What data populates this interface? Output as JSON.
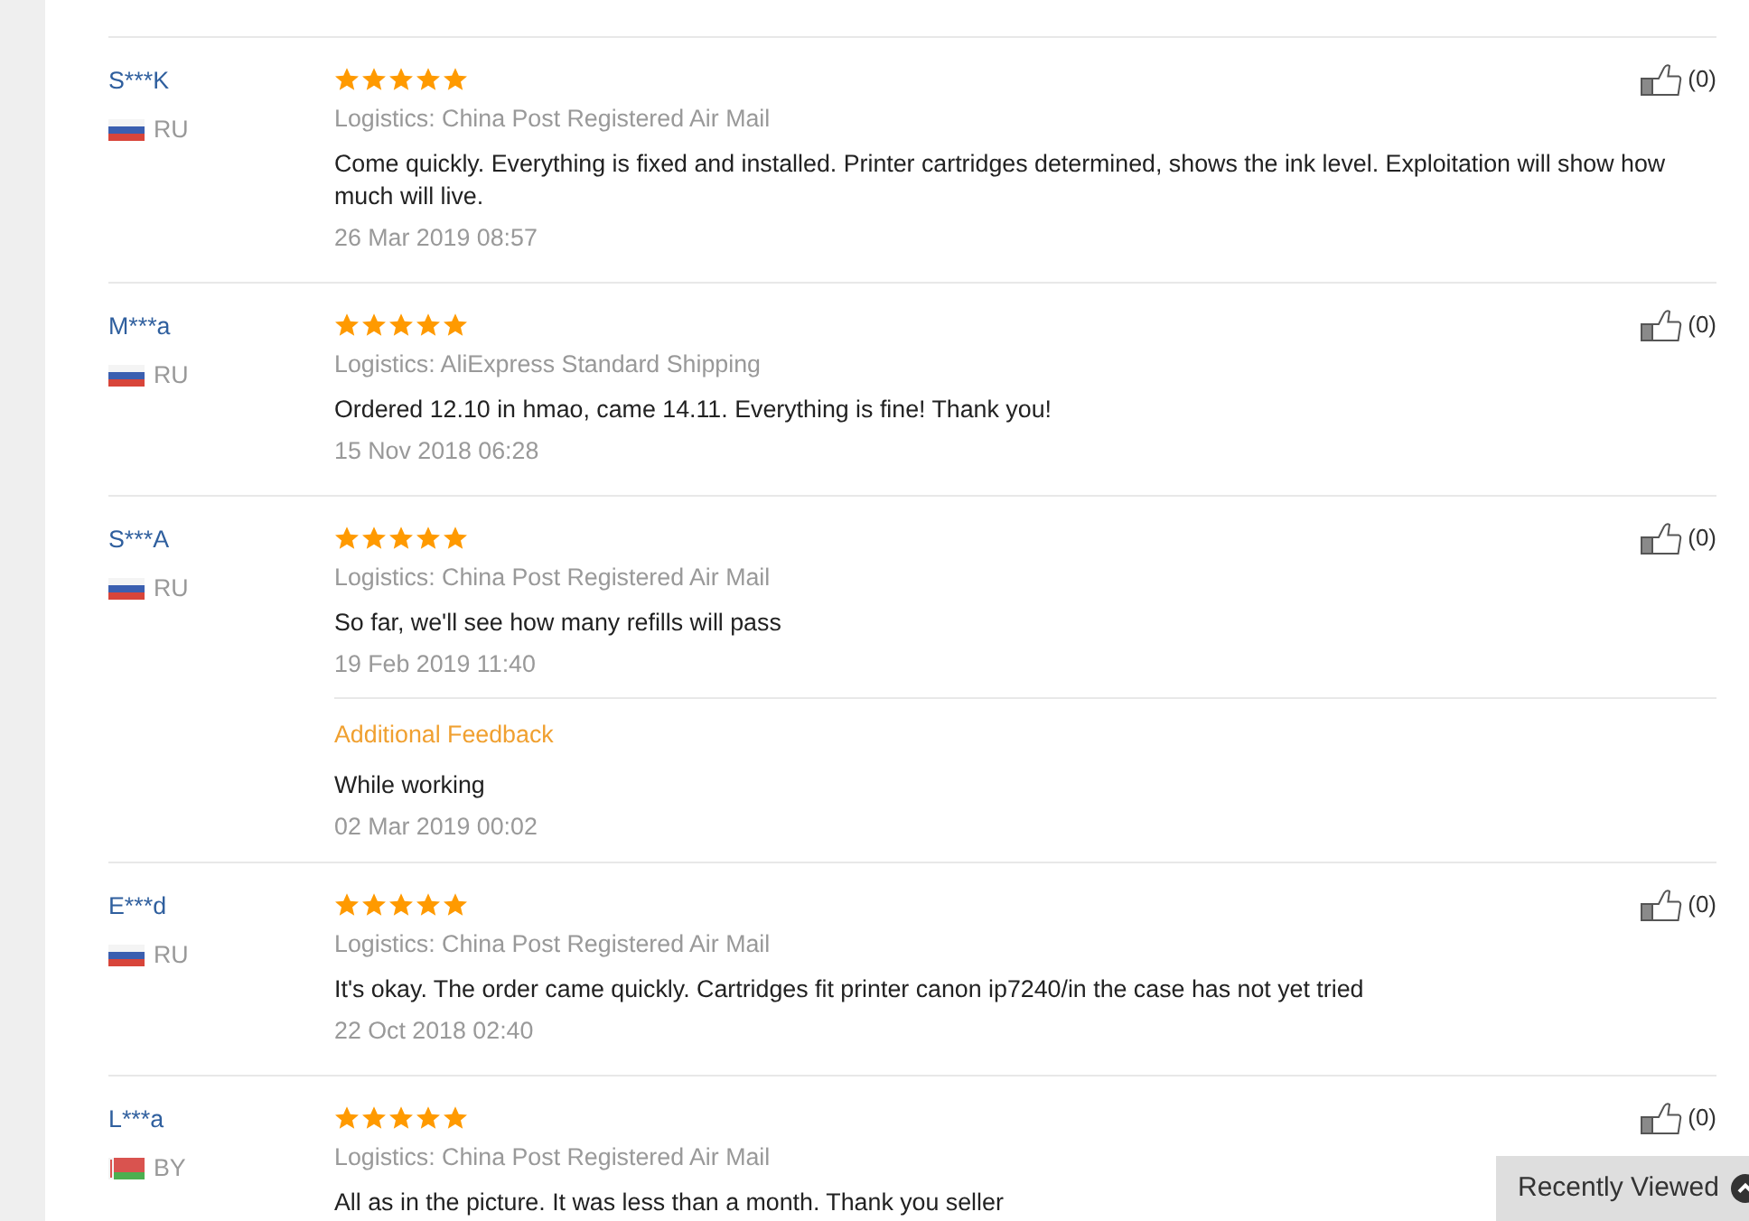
{
  "reviews": [
    {
      "user": "S***K",
      "flag": {
        "kind": "russia"
      },
      "country": "RU",
      "stars": 5,
      "likes": "(0)",
      "logistics": "Logistics: China Post Registered Air Mail",
      "text": "Come quickly. Everything is fixed and installed. Printer cartridges determined, shows the ink level. Exploitation will show how much will live.",
      "date": "26 Mar 2019 08:57"
    },
    {
      "user": "M***a",
      "flag": {
        "kind": "russia"
      },
      "country": "RU",
      "stars": 5,
      "likes": "(0)",
      "logistics": "Logistics: AliExpress Standard Shipping",
      "text": "Ordered 12.10 in hmao, came 14.11. Everything is fine! Thank you!",
      "date": "15 Nov 2018 06:28"
    },
    {
      "user": "S***A",
      "flag": {
        "kind": "russia"
      },
      "country": "RU",
      "stars": 5,
      "likes": "(0)",
      "logistics": "Logistics: China Post Registered Air Mail",
      "text": "So far, we'll see how many refills will pass",
      "date": "19 Feb 2019 11:40",
      "additional": {
        "title": "Additional Feedback",
        "text": "While working",
        "date": "02 Mar 2019 00:02"
      }
    },
    {
      "user": "E***d",
      "flag": {
        "kind": "russia"
      },
      "country": "RU",
      "stars": 5,
      "likes": "(0)",
      "logistics": "Logistics: China Post Registered Air Mail",
      "text": "It's okay. The order came quickly. Cartridges fit printer canon ip7240/in the case has not yet tried",
      "date": "22 Oct 2018 02:40"
    },
    {
      "user": "L***a",
      "flag": {
        "kind": "belarus"
      },
      "country": "BY",
      "stars": 5,
      "likes": "(0)",
      "logistics": "Logistics: China Post Registered Air Mail",
      "text": "All as in the picture. It was less than a month. Thank you seller"
    }
  ],
  "recently_viewed": {
    "label": "Recently Viewed"
  }
}
